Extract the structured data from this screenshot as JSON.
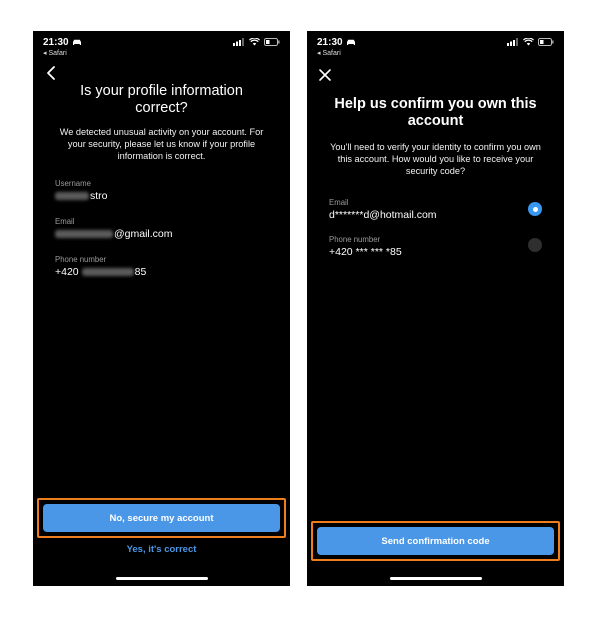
{
  "left": {
    "status": {
      "time": "21:30",
      "back_app": "◂ Safari"
    },
    "title": "Is your profile information correct?",
    "description": "We detected unusual activity on your account. For your security, please let us know if your profile information is correct.",
    "fields": [
      {
        "label": "Username",
        "value_suffix": "stro"
      },
      {
        "label": "Email",
        "value_suffix": "@gmail.com"
      },
      {
        "label": "Phone number",
        "value_prefix": "+420",
        "value_suffix": "85"
      }
    ],
    "primary_button": "No, secure my account",
    "secondary_button": "Yes, it's correct"
  },
  "right": {
    "status": {
      "time": "21:30",
      "back_app": "◂ Safari"
    },
    "title": "Help us confirm you own this account",
    "description": "You'll need to verify your identity to confirm you own this account. How would you like to receive your security code?",
    "options": [
      {
        "label": "Email",
        "value": "d*******d@hotmail.com",
        "selected": true
      },
      {
        "label": "Phone number",
        "value": "+420 *** *** *85",
        "selected": false
      }
    ],
    "primary_button": "Send confirmation code"
  },
  "colors": {
    "accent": "#4a97e8",
    "highlight": "#ee7d1b",
    "background": "#000000"
  },
  "icons": {
    "left_nav": "back-chevron-icon",
    "right_nav": "close-icon"
  }
}
